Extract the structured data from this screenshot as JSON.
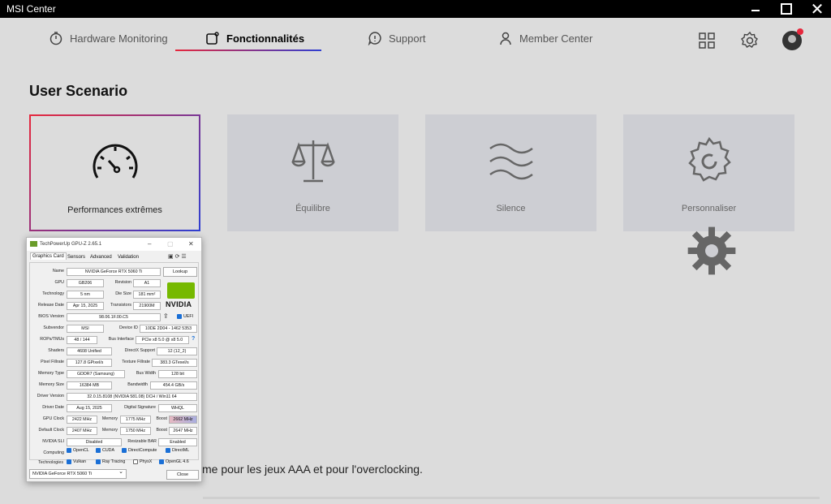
{
  "window": {
    "title": "MSI Center"
  },
  "nav": {
    "tabs": [
      {
        "label": "Hardware Monitoring"
      },
      {
        "label": "Fonctionnalités"
      },
      {
        "label": "Support"
      },
      {
        "label": "Member Center"
      }
    ],
    "active_tab": "Fonctionnalités"
  },
  "top_icons": [
    "grid-icon",
    "settings-gear-icon",
    "avatar"
  ],
  "main": {
    "section_title": "User Scenario",
    "cards": [
      {
        "label": "Performances extrêmes",
        "icon": "speedometer-icon",
        "selected": true
      },
      {
        "label": "Équilibre",
        "icon": "balance-scale-icon",
        "selected": false
      },
      {
        "label": "Silence",
        "icon": "waves-icon",
        "selected": false
      },
      {
        "label": "Personnaliser",
        "icon": "gear-icon",
        "selected": false
      }
    ],
    "description": "me pour les jeux AAA et pour l'overclocking."
  },
  "gpuz": {
    "title": "TechPowerUp GPU-Z 2.65.1",
    "tabs": [
      "Graphics Card",
      "Sensors",
      "Advanced",
      "Validation"
    ],
    "labels": {
      "name": "Name",
      "gpu": "GPU",
      "revision": "Revision",
      "technology": "Technology",
      "die_size": "Die Size",
      "release_date": "Release Date",
      "transistors": "Transistors",
      "bios": "BIOS Version",
      "subvendor": "Subvendor",
      "device_id": "Device ID",
      "rops": "ROPs/TMUs",
      "bus_interface": "Bus Interface",
      "shaders": "Shaders",
      "directx": "DirectX Support",
      "pixel_fillrate": "Pixel Fillrate",
      "texture_fillrate": "Texture Fillrate",
      "memory_type": "Memory Type",
      "bus_width": "Bus Width",
      "memory_size": "Memory Size",
      "bandwidth": "Bandwidth",
      "driver_version": "Driver Version",
      "driver_date": "Driver Date",
      "digital_signature": "Digital Signature",
      "gpu_clock": "GPU Clock",
      "memory": "Memory",
      "boost": "Boost",
      "default_clock": "Default Clock",
      "sli": "NVIDIA SLI",
      "resizable_bar": "Resizable BAR",
      "computing": "Computing",
      "technologies": "Technologies"
    },
    "values": {
      "name": "NVIDIA GeForce RTX 5060 Ti",
      "gpu": "GB206",
      "revision": "A1",
      "technology": "5 nm",
      "die_size": "181 mm²",
      "release_date": "Apr 15, 2025",
      "transistors": "21900M",
      "bios": "98.06.1F.00.C5",
      "uefi": "UEFI",
      "subvendor": "MSI",
      "device_id": "10DE 2D04 - 1462 5353",
      "rops": "48 / 144",
      "bus_interface": "PCIe x8 5.0 @ x8 5.0",
      "shaders": "4608 Unified",
      "directx": "12 (12_2)",
      "pixel_fillrate": "127.8 GPixel/s",
      "texture_fillrate": "383.3 GTexel/s",
      "memory_type": "GDDR7 (Samsung)",
      "bus_width": "128 bit",
      "memory_size": "16384 MB",
      "bandwidth": "454.4 GB/s",
      "driver_version": "32.0.15.8108 (NVIDIA 581.08) DCH / Win11 64",
      "driver_date": "Aug 15, 2025",
      "digital_signature": "WHQL",
      "gpu_clock": "2422 MHz",
      "gpu_memory": "1775 MHz",
      "gpu_boost": "2662 MHz",
      "default_clock": "2407 MHz",
      "default_memory": "1750 MHz",
      "default_boost": "2647 MHz",
      "sli": "Disabled",
      "resizable_bar": "Enabled"
    },
    "computing": [
      "OpenCL",
      "CUDA",
      "DirectCompute",
      "DirectML"
    ],
    "technologies": [
      "Vulkan",
      "Ray Tracing",
      "PhysX",
      "OpenGL 4.6"
    ],
    "technologies_checked": [
      true,
      true,
      false,
      true
    ],
    "lookup_label": "Lookup",
    "brand": "NVIDIA",
    "selected_gpu": "NVIDIA GeForce RTX 5060 Ti",
    "close_label": "Close"
  }
}
